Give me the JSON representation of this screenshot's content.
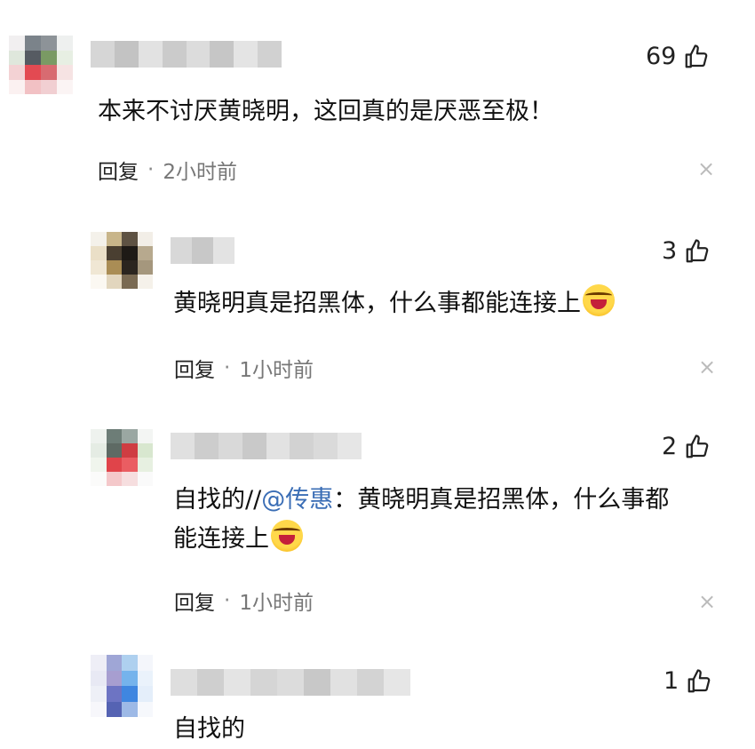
{
  "comments": [
    {
      "likes": "69",
      "text": "本来不讨厌黄晓明，这回真的是厌恶至极！",
      "reply_label": "回复",
      "separator": "·",
      "time": "2小时前",
      "close": "×"
    },
    {
      "likes": "3",
      "text": "黄晓明真是招黑体，什么事都能连接上",
      "reply_label": "回复",
      "separator": "·",
      "time": "1小时前",
      "close": "×"
    },
    {
      "likes": "2",
      "text_prefix": "自找的//",
      "mention": "@传惠",
      "text_line1_rest": "：黄晓明真是招黑体，什么事都",
      "text_line2": "能连接上",
      "reply_label": "回复",
      "separator": "·",
      "time": "1小时前",
      "close": "×"
    },
    {
      "likes": "1",
      "text_partial": "自找的"
    }
  ],
  "icons": {
    "like": "thumbs-up-icon",
    "emoji": "laughing-crying-emoji-icon"
  },
  "colors": {
    "mention": "#3a6db5",
    "text": "#111111",
    "meta": "#777777"
  }
}
